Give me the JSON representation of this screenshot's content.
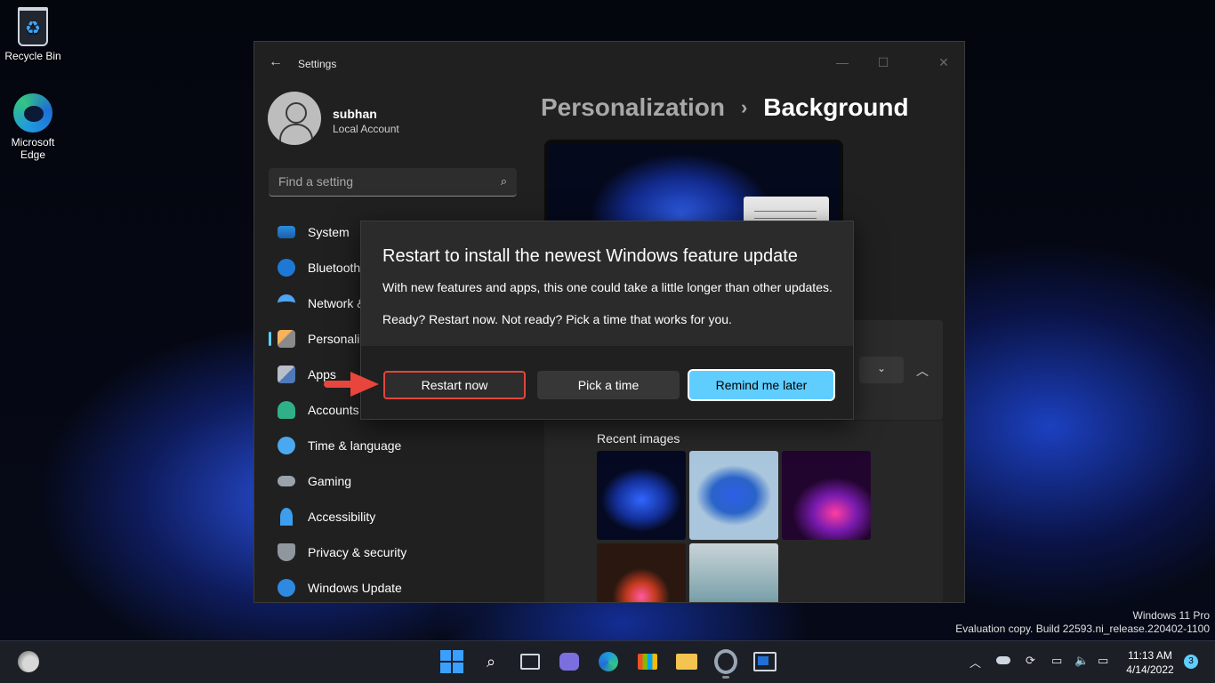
{
  "desktop": {
    "icons": [
      {
        "label": "Recycle Bin"
      },
      {
        "label": "Microsoft Edge"
      }
    ],
    "watermark": {
      "line1": "Windows 11 Pro",
      "line2": "Evaluation copy. Build 22593.ni_release.220402-1100"
    }
  },
  "settings": {
    "title": "Settings",
    "user": {
      "name": "subhan",
      "type": "Local Account"
    },
    "search": {
      "placeholder": "Find a setting"
    },
    "nav": [
      {
        "label": "System",
        "icon": "system-icon"
      },
      {
        "label": "Bluetooth & devices",
        "icon": "bluetooth-icon"
      },
      {
        "label": "Network & internet",
        "icon": "network-icon"
      },
      {
        "label": "Personalization",
        "icon": "personalization-icon",
        "selected": true
      },
      {
        "label": "Apps",
        "icon": "apps-icon"
      },
      {
        "label": "Accounts",
        "icon": "accounts-icon"
      },
      {
        "label": "Time & language",
        "icon": "time-icon"
      },
      {
        "label": "Gaming",
        "icon": "gaming-icon"
      },
      {
        "label": "Accessibility",
        "icon": "accessibility-icon"
      },
      {
        "label": "Privacy & security",
        "icon": "privacy-icon"
      },
      {
        "label": "Windows Update",
        "icon": "update-icon"
      }
    ],
    "breadcrumb": {
      "parent": "Personalization",
      "separator": "›",
      "current": "Background"
    },
    "recent_images_label": "Recent images"
  },
  "dialog": {
    "title": "Restart to install the newest Windows feature update",
    "message1": "With new features and apps, this one could take a little longer than other updates.",
    "message2": "Ready? Restart now. Not ready? Pick a time that works for you.",
    "buttons": {
      "restart": "Restart now",
      "pick": "Pick a time",
      "remind": "Remind me later"
    }
  },
  "taskbar": {
    "time": "11:13 AM",
    "date": "4/14/2022",
    "notification_count": "3"
  },
  "colors": {
    "accent": "#60cdff",
    "highlight_border": "#e0463d"
  }
}
